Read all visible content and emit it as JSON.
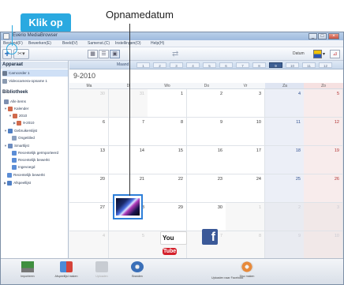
{
  "callouts": {
    "add_label": "Klik op",
    "date_label": "Opnamedatum"
  },
  "window": {
    "title": "Everio MediaBrowser",
    "buttons": [
      "_",
      "□",
      "×"
    ]
  },
  "menu": {
    "items": [
      "Bestand(F)",
      "Bewerken(E)",
      "Beeld(V)",
      "Samenst.(C)",
      "Instellingen(O)",
      "Help(H)"
    ]
  },
  "toolbar": {
    "add_symbol": "+",
    "tool_symbol": "✂▾",
    "view_buttons": [
      "▦",
      "☰",
      "▣"
    ],
    "date_label": "Datum",
    "color_arrow": "▾",
    "chart_symbol": "⊿"
  },
  "left": {
    "device_header": "Apparaat",
    "device_items": [
      "Camcorder 1",
      "Videocamera-opname 1"
    ],
    "library_header": "Bibliotheek",
    "library_items": [
      "Alle items",
      "Kalender",
      "2010",
      "9-2010",
      "Gebruikerslijst",
      "Ongetitled",
      "Smartlijst",
      "Recentelijk geïmporteerd",
      "Recentelijk bewerkt",
      "Ingevoegd",
      "Recentelijk bewerkt",
      "Afspeellijst"
    ]
  },
  "calendar": {
    "month_prefix": "Maand",
    "months": [
      "1",
      "2",
      "3",
      "4",
      "5",
      "6",
      "7",
      "8",
      "9",
      "10",
      "11",
      "12"
    ],
    "active_month": "9",
    "title": "9-2010",
    "weekdays": [
      "Ma",
      "Di",
      "Wo",
      "Do",
      "Vr",
      "Za",
      "Zo"
    ],
    "weeks": [
      [
        {
          "d": "30",
          "o": true
        },
        {
          "d": "31",
          "o": true
        },
        {
          "d": "1"
        },
        {
          "d": "2"
        },
        {
          "d": "3"
        },
        {
          "d": "4"
        },
        {
          "d": "5"
        }
      ],
      [
        {
          "d": "6"
        },
        {
          "d": "7"
        },
        {
          "d": "8"
        },
        {
          "d": "9"
        },
        {
          "d": "10"
        },
        {
          "d": "11"
        },
        {
          "d": "12"
        }
      ],
      [
        {
          "d": "13"
        },
        {
          "d": "14"
        },
        {
          "d": "15"
        },
        {
          "d": "16"
        },
        {
          "d": "17"
        },
        {
          "d": "18"
        },
        {
          "d": "19"
        }
      ],
      [
        {
          "d": "20"
        },
        {
          "d": "21"
        },
        {
          "d": "22"
        },
        {
          "d": "23"
        },
        {
          "d": "24"
        },
        {
          "d": "25"
        },
        {
          "d": "26"
        }
      ],
      [
        {
          "d": "27"
        },
        {
          "d": "28"
        },
        {
          "d": "29"
        },
        {
          "d": "30"
        },
        {
          "d": "1",
          "o": true
        },
        {
          "d": "2",
          "o": true
        },
        {
          "d": "3",
          "o": true
        }
      ],
      [
        {
          "d": "4",
          "o": true
        },
        {
          "d": "5",
          "o": true
        },
        {
          "d": "6",
          "o": true
        },
        {
          "d": "7",
          "o": true
        },
        {
          "d": "8",
          "o": true
        },
        {
          "d": "9",
          "o": true
        },
        {
          "d": "10",
          "o": true
        }
      ]
    ]
  },
  "bottom": {
    "buttons": [
      "Importeren",
      "Afspeellijst maken",
      "Uploaden",
      "Branden",
      "Uploaden naar Facebook",
      "Disc maken"
    ],
    "youtube_you": "You",
    "youtube_tube": "Tube",
    "facebook_letter": "f"
  },
  "colors": {
    "callout": "#2aa9e0",
    "selected_border": "#2e7fd9",
    "active_month": "#3d5f93",
    "saturday": "#eceff7",
    "sunday": "#f8ecec"
  }
}
